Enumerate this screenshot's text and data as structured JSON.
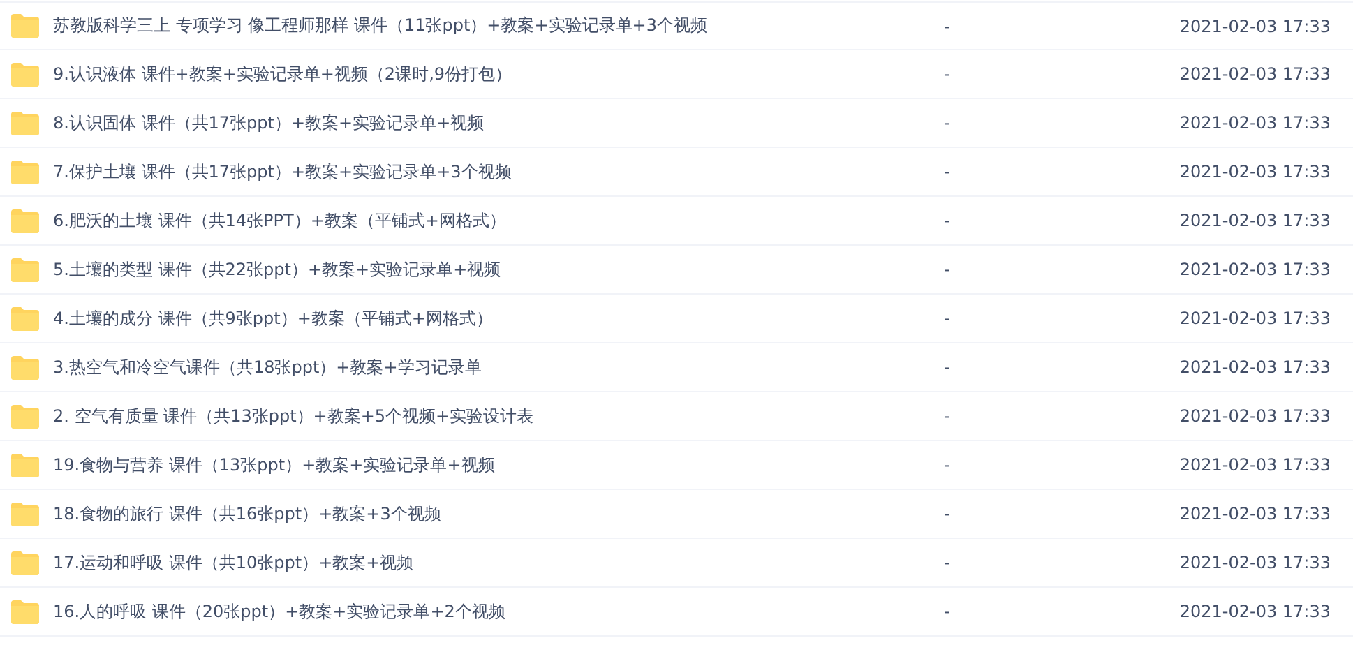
{
  "files": [
    {
      "name": "苏教版科学三上 专项学习 像工程师那样 课件（11张ppt）+教案+实验记录单+3个视频",
      "size": "-",
      "modified": "2021-02-03 17:33"
    },
    {
      "name": "9.认识液体 课件+教案+实验记录单+视频（2课时,9份打包）",
      "size": "-",
      "modified": "2021-02-03 17:33"
    },
    {
      "name": "8.认识固体 课件（共17张ppt）+教案+实验记录单+视频",
      "size": "-",
      "modified": "2021-02-03 17:33"
    },
    {
      "name": "7.保护土壤 课件（共17张ppt）+教案+实验记录单+3个视频",
      "size": "-",
      "modified": "2021-02-03 17:33"
    },
    {
      "name": "6.肥沃的土壤 课件（共14张PPT）+教案（平铺式+网格式）",
      "size": "-",
      "modified": "2021-02-03 17:33"
    },
    {
      "name": "5.土壤的类型 课件（共22张ppt）+教案+实验记录单+视频",
      "size": "-",
      "modified": "2021-02-03 17:33"
    },
    {
      "name": "4.土壤的成分 课件（共9张ppt）+教案（平铺式+网格式）",
      "size": "-",
      "modified": "2021-02-03 17:33"
    },
    {
      "name": "3.热空气和冷空气课件（共18张ppt）+教案+学习记录单",
      "size": "-",
      "modified": "2021-02-03 17:33"
    },
    {
      "name": "2. 空气有质量 课件（共13张ppt）+教案+5个视频+实验设计表",
      "size": "-",
      "modified": "2021-02-03 17:33"
    },
    {
      "name": "19.食物与营养 课件（13张ppt）+教案+实验记录单+视频",
      "size": "-",
      "modified": "2021-02-03 17:33"
    },
    {
      "name": "18.食物的旅行 课件（共16张ppt）+教案+3个视频",
      "size": "-",
      "modified": "2021-02-03 17:33"
    },
    {
      "name": "17.运动和呼吸 课件（共10张ppt）+教案+视频",
      "size": "-",
      "modified": "2021-02-03 17:33"
    },
    {
      "name": "16.人的呼吸 课件（20张ppt）+教案+实验记录单+2个视频",
      "size": "-",
      "modified": "2021-02-03 17:33"
    }
  ]
}
